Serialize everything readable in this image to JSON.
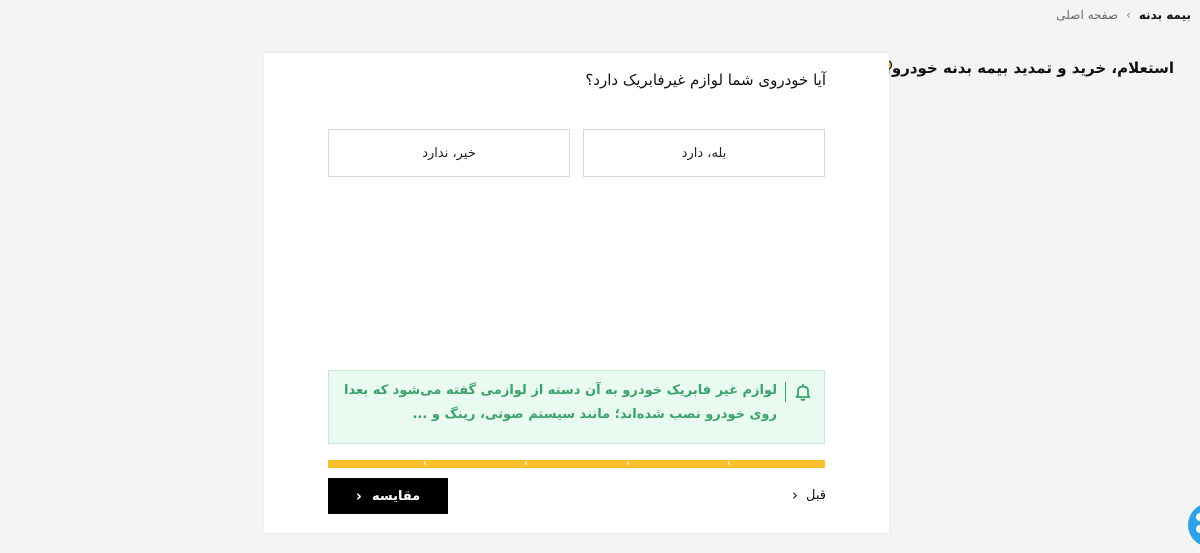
{
  "breadcrumb": {
    "home": "صفحه اصلی",
    "current": "بیمه بدنه"
  },
  "header": {
    "title": "استعلام، خرید و تمدید بیمه بدنه خودرو",
    "icon": "car-insurance-icon"
  },
  "question": {
    "text": "آیا خودروی شما لوازم غیرفابریک دارد؟",
    "options": [
      {
        "label": "بله، دارد"
      },
      {
        "label": "خیر، ندارد"
      }
    ]
  },
  "notice": {
    "icon": "bell-icon",
    "text": "لوازم غیر فابریک خودرو به آن دسته از لوازمی گفته می‌شود که بعدا روی خودرو نصب شده‌اند؛ مانند سیستم صوتی، رینگ و ..."
  },
  "progress": {
    "steps": 5,
    "color": "#fbc02d"
  },
  "footer": {
    "prev_label": "قبل",
    "compare_label": "مقایسه"
  },
  "colors": {
    "accent": "#fbc02d",
    "notice_text": "#3aa36b",
    "notice_bg": "#e9faf1",
    "chat_button": "#2ea2e6"
  }
}
